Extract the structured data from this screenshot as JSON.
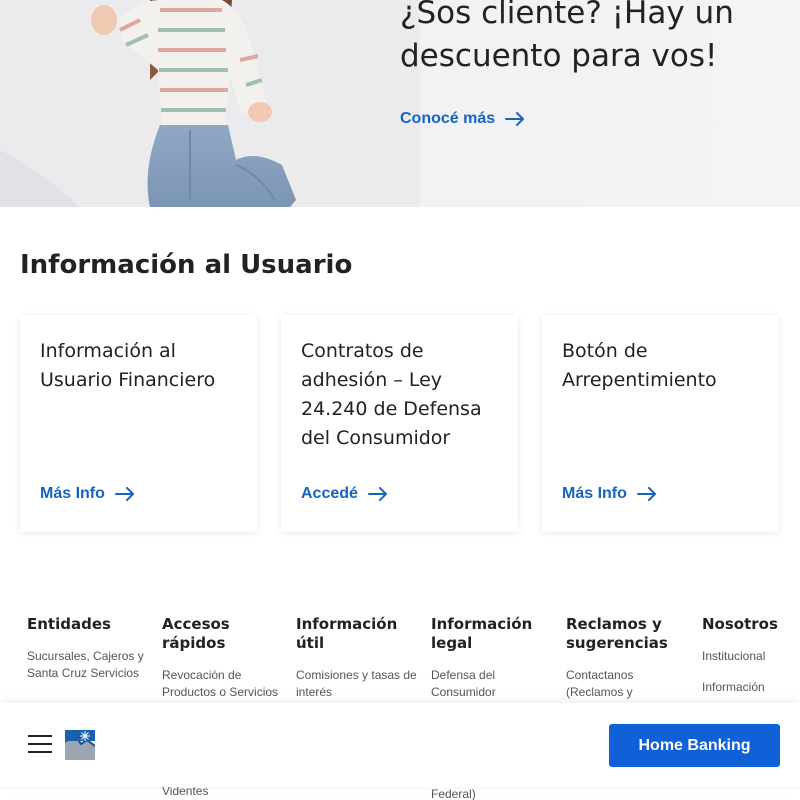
{
  "hero": {
    "title": "¿Sos cliente? ¡Hay un descuento para vos!",
    "link_label": "Conocé más"
  },
  "user_info": {
    "title": "Información al Usuario",
    "cards": [
      {
        "title": "Información al Usuario Financiero",
        "link": "Más Info"
      },
      {
        "title": "Contratos de adhesión – Ley 24.240 de Defensa del Consumidor",
        "link": "Accedé"
      },
      {
        "title": "Botón de Arrepentimiento",
        "link": "Más Info"
      }
    ]
  },
  "footer": {
    "columns": [
      {
        "title": "Entidades",
        "links": [
          "Sucursales, Cajeros y Santa Cruz Servicios"
        ]
      },
      {
        "title": "Accesos rápidos",
        "links": [
          "Revocación de Productos o Servicios"
        ]
      },
      {
        "title": "Información útil",
        "links": [
          "Comisiones y tasas de interés"
        ]
      },
      {
        "title": "Información legal",
        "links": [
          "Defensa del Consumidor"
        ]
      },
      {
        "title": "Reclamos y sugerencias",
        "links": [
          "Contactanos (Reclamos y"
        ]
      },
      {
        "title": "Nosotros",
        "links": [
          "Institucional",
          "Información"
        ]
      }
    ],
    "partial_texts": [
      "Videntes",
      "Federal)"
    ]
  },
  "bottom_bar": {
    "home_banking_label": "Home Banking",
    "menu_icon": "hamburger-menu-icon",
    "logo_icon": "bank-logo-icon"
  },
  "colors": {
    "accent": "#1565c0",
    "button_bg": "#1060d8"
  }
}
